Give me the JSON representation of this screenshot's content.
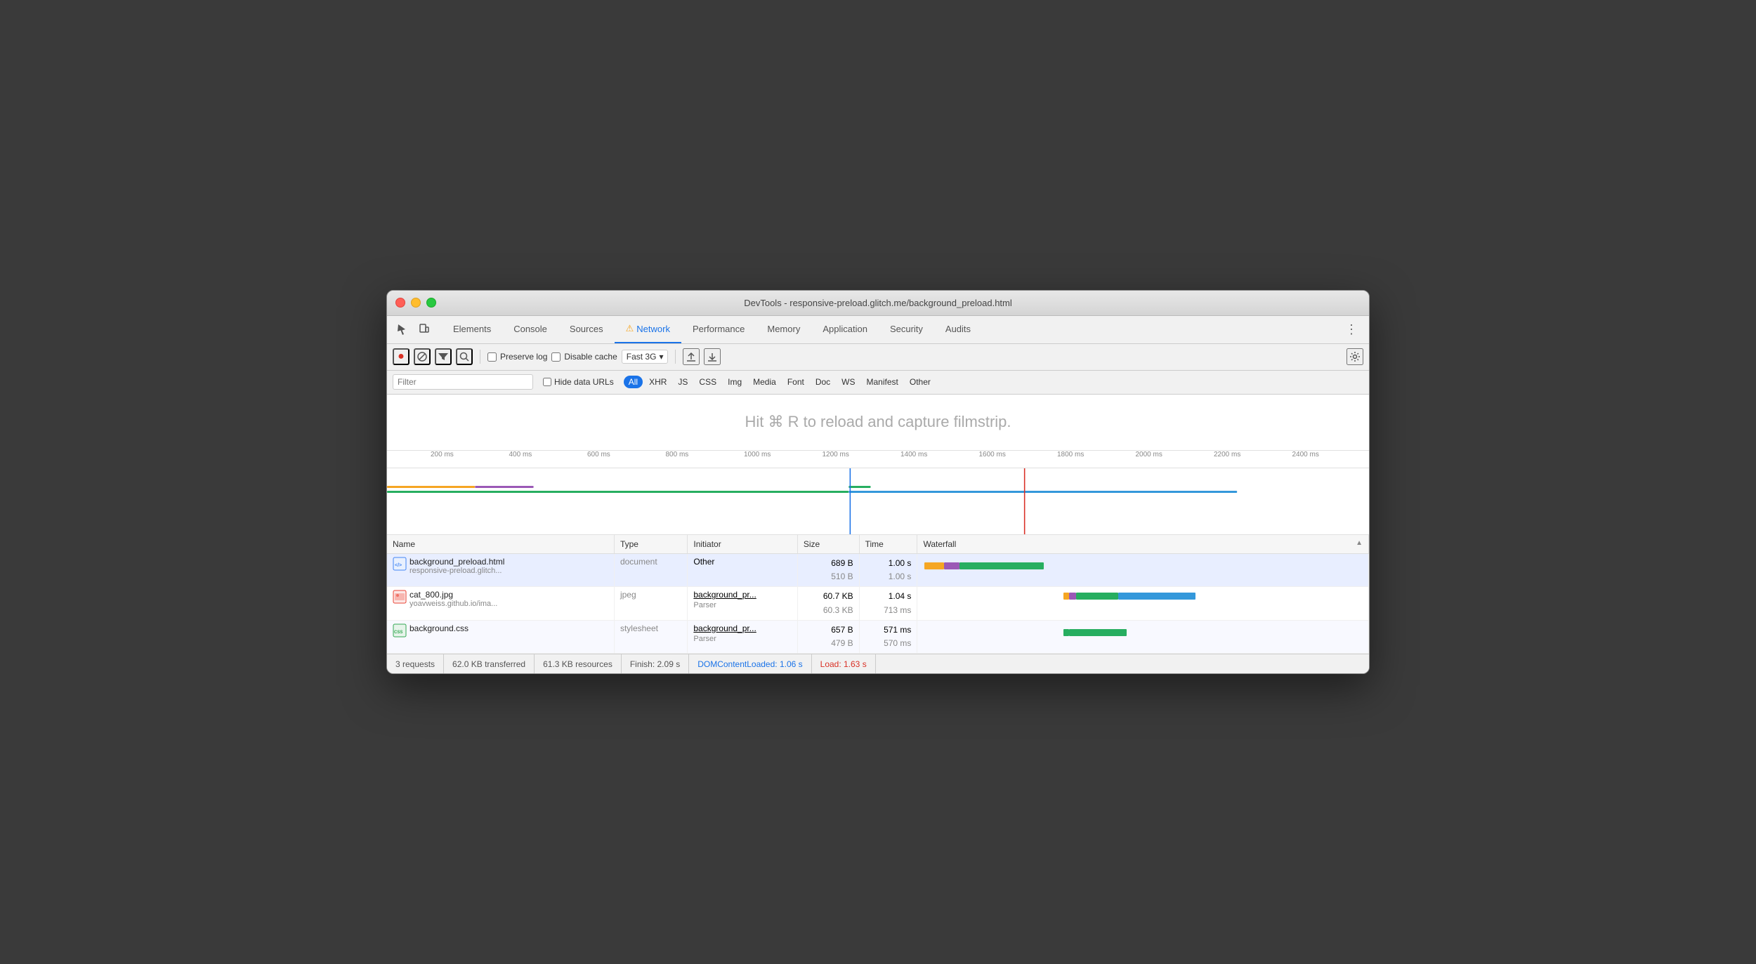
{
  "window": {
    "title": "DevTools - responsive-preload.glitch.me/background_preload.html"
  },
  "tabs": [
    {
      "label": "Elements",
      "active": false
    },
    {
      "label": "Console",
      "active": false
    },
    {
      "label": "Sources",
      "active": false
    },
    {
      "label": "Network",
      "active": true,
      "icon": "⚠"
    },
    {
      "label": "Performance",
      "active": false
    },
    {
      "label": "Memory",
      "active": false
    },
    {
      "label": "Application",
      "active": false
    },
    {
      "label": "Security",
      "active": false
    },
    {
      "label": "Audits",
      "active": false
    }
  ],
  "toolbar": {
    "preserve_log": "Preserve log",
    "disable_cache": "Disable cache",
    "throttle": "Fast 3G"
  },
  "filter_bar": {
    "placeholder": "Filter",
    "hide_data_urls": "Hide data URLs",
    "types": [
      "All",
      "XHR",
      "JS",
      "CSS",
      "Img",
      "Media",
      "Font",
      "Doc",
      "WS",
      "Manifest",
      "Other"
    ]
  },
  "filmstrip": {
    "hint": "Hit ⌘ R to reload and capture filmstrip."
  },
  "timeline": {
    "marks": [
      "200 ms",
      "400 ms",
      "600 ms",
      "800 ms",
      "1000 ms",
      "1200 ms",
      "1400 ms",
      "1600 ms",
      "1800 ms",
      "2000 ms",
      "2200 ms",
      "2400 ms"
    ]
  },
  "table": {
    "headers": [
      "Name",
      "Type",
      "Initiator",
      "Size",
      "Time",
      "Waterfall"
    ],
    "rows": [
      {
        "name": "background_preload.html",
        "name_sub": "responsive-preload.glitch...",
        "type": "document",
        "initiator": "Other",
        "size": "689 B",
        "size_sub": "510 B",
        "time": "1.00 s",
        "time_sub": "1.00 s",
        "icon_type": "html"
      },
      {
        "name": "cat_800.jpg",
        "name_sub": "yoavweiss.github.io/ima...",
        "type": "jpeg",
        "initiator": "background_pr...",
        "initiator_sub": "Parser",
        "size": "60.7 KB",
        "size_sub": "60.3 KB",
        "time": "1.04 s",
        "time_sub": "713 ms",
        "icon_type": "img"
      },
      {
        "name": "background.css",
        "name_sub": "",
        "type": "stylesheet",
        "initiator": "background_pr...",
        "initiator_sub": "Parser",
        "size": "657 B",
        "size_sub": "479 B",
        "time": "571 ms",
        "time_sub": "570 ms",
        "icon_type": "css"
      }
    ]
  },
  "status_bar": {
    "requests": "3 requests",
    "transferred": "62.0 KB transferred",
    "resources": "61.3 KB resources",
    "finish": "Finish: 2.09 s",
    "dom_content_loaded": "DOMContentLoaded: 1.06 s",
    "load": "Load: 1.63 s"
  }
}
